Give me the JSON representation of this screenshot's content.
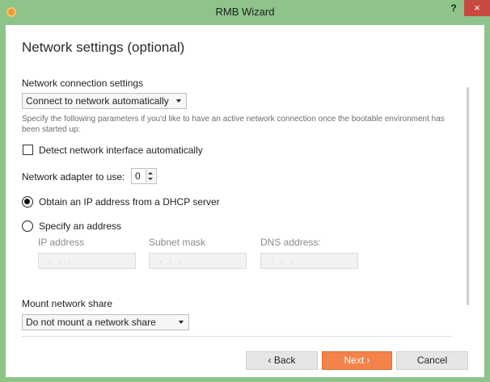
{
  "window": {
    "title": "RMB Wizard",
    "help_label": "?",
    "close_label": "×",
    "icon": "app-icon",
    "title_bar_color": "#8ec48a"
  },
  "page": {
    "title": "Network settings (optional)"
  },
  "network": {
    "section_label": "Network connection settings",
    "connection_mode": "Connect to network automatically",
    "hint": "Specify the following parameters if you'd like to have an active network connection once the bootable environment has been started up:",
    "detect_label": "Detect network interface automatically",
    "detect_checked": false,
    "adapter_label": "Network adapter to use:",
    "adapter_value": "0",
    "dhcp_label": "Obtain an IP address from a DHCP server",
    "dhcp_selected": true,
    "specify_label": "Specify an address",
    "specify_selected": false,
    "ip_label": "IP address",
    "subnet_label": "Subnet mask",
    "dns_label": "DNS address:",
    "ip_value": ". . .",
    "subnet_value": ". . .",
    "dns_value": ". . ."
  },
  "share": {
    "section_label": "Mount network share",
    "mode": "Do not mount a network share"
  },
  "footer": {
    "back_label": "‹ Back",
    "next_label": "Next ›",
    "cancel_label": "Cancel",
    "next_color": "#f3834a"
  }
}
